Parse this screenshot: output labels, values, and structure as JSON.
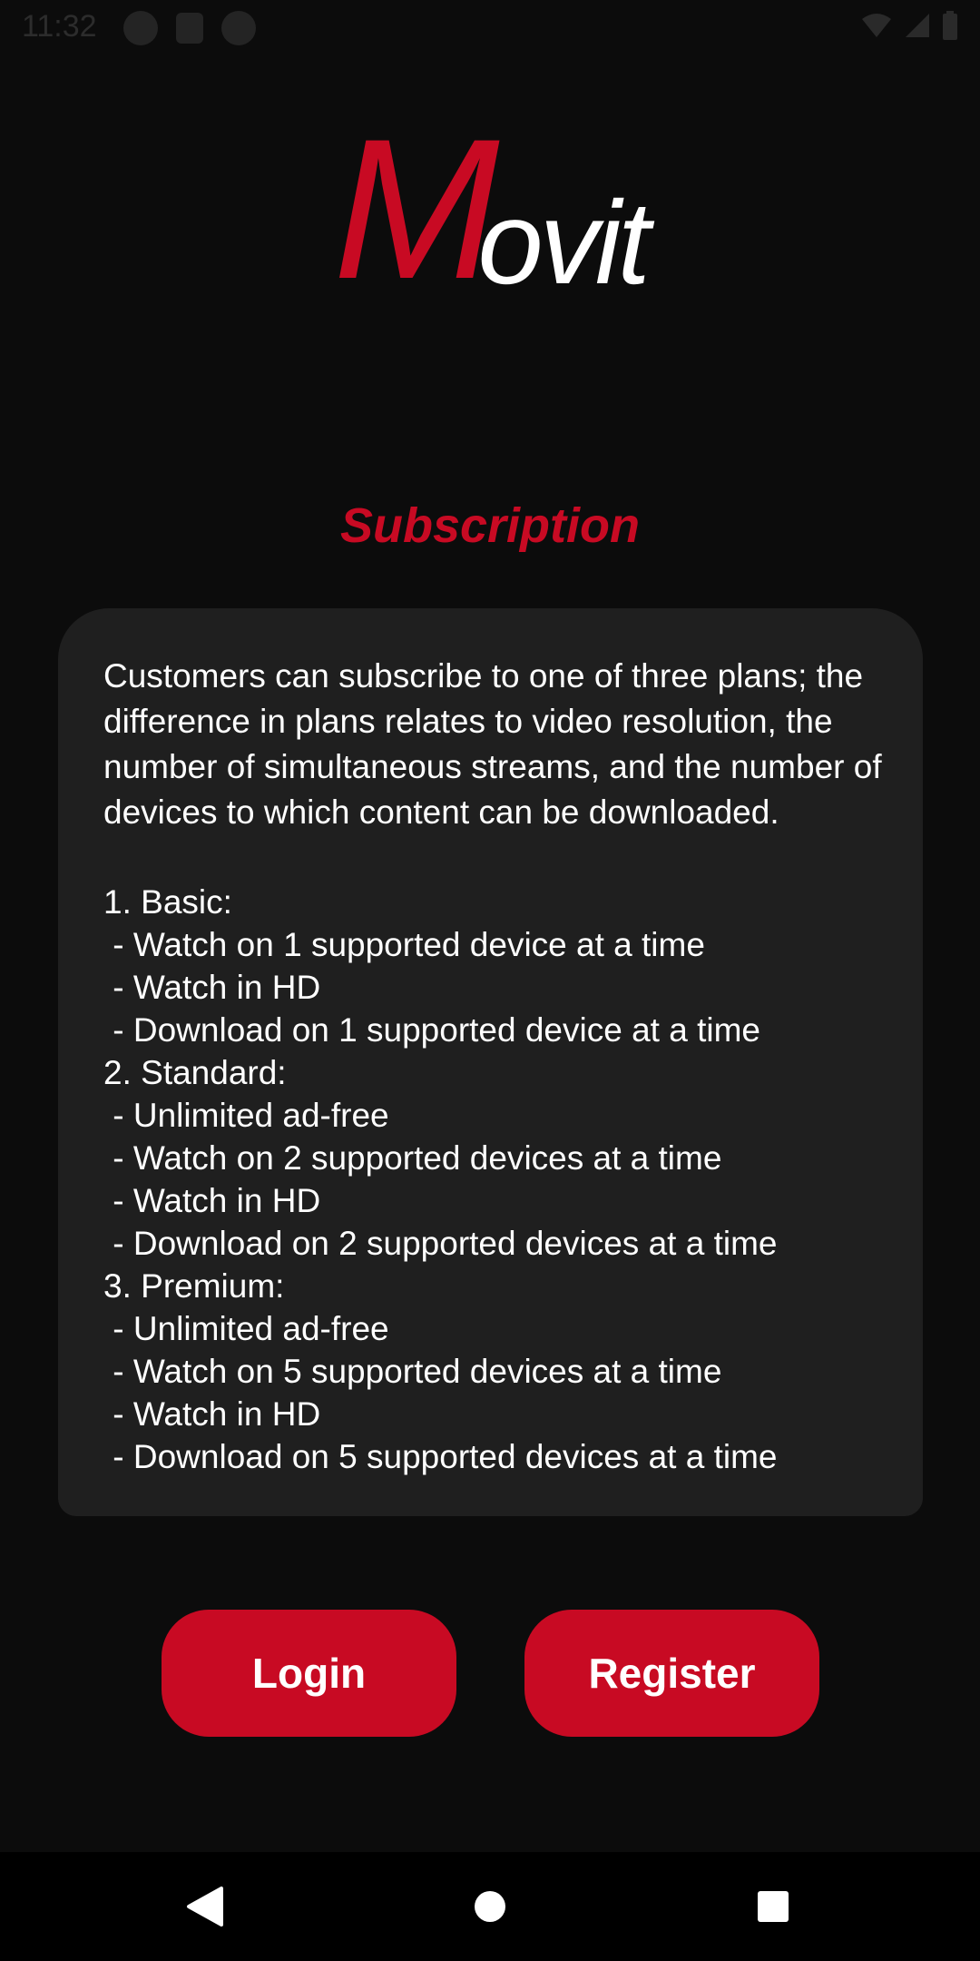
{
  "status_bar": {
    "time": "11:32"
  },
  "logo": {
    "first_letter": "M",
    "rest": "ovit",
    "colors": {
      "accent": "#c80a23",
      "text": "#ffffff"
    }
  },
  "page": {
    "title": "Subscription"
  },
  "description": {
    "intro": "Customers can subscribe to one of three plans; the difference in plans relates to video resolution, the number of simultaneous streams, and the number of devices to which content can be downloaded.",
    "lines": [
      "1. Basic:",
      " - Watch on 1 supported device at a time",
      " - Watch in HD",
      " - Download on 1 supported device at a time",
      "2. Standard:",
      " - Unlimited ad-free",
      " - Watch on 2 supported devices at a time",
      " - Watch in HD",
      " - Download on 2 supported devices at a time",
      "3. Premium:",
      " - Unlimited ad-free",
      " - Watch on 5 supported devices at a time",
      " - Watch in HD",
      " - Download on 5 supported devices at a time"
    ]
  },
  "actions": {
    "login_label": "Login",
    "register_label": "Register"
  },
  "nav_bar": {
    "icons": [
      "back-icon",
      "home-icon",
      "recents-icon"
    ]
  },
  "colors": {
    "background": "#0c0c0c",
    "card": "#1f1f1f",
    "accent": "#c80a23"
  }
}
